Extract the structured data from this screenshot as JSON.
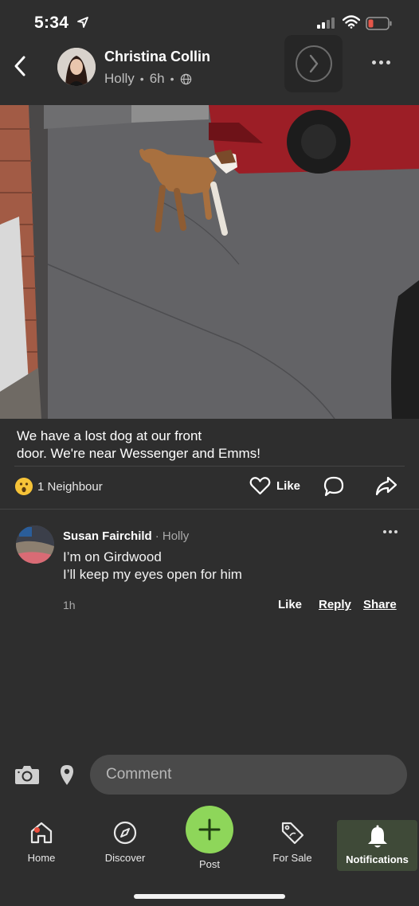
{
  "status_bar": {
    "time": "5:34",
    "icons": [
      "location-arrow-icon",
      "signal-icon",
      "wifi-icon",
      "battery-low-icon"
    ],
    "battery_color": "#e5574a"
  },
  "post": {
    "author_name": "Christina Collin",
    "neighbourhood": "Holly",
    "time_ago": "6h",
    "text": "We have a lost dog at our front\n door. We're near Wessenger and Emms!",
    "reaction_count_label": "1 Neighbour",
    "like_label": "Like"
  },
  "comment": {
    "author": "Susan Fairchild",
    "location": "· Holly",
    "body": "I’m on Girdwood\nI’ll keep my eyes open for him",
    "time_ago": "1h",
    "like_label": "Like",
    "reply_label": "Reply",
    "share_label": "Share"
  },
  "composer": {
    "placeholder": "Comment"
  },
  "tab_bar": {
    "home": "Home",
    "discover": "Discover",
    "post": "Post",
    "for_sale": "For Sale",
    "notifications": "Notifications"
  },
  "colors": {
    "background": "#2e2e2e",
    "accent_green": "#8ed65a",
    "active_tab_bg": "#3f4a38",
    "notification_dot": "#ea4e3d"
  }
}
